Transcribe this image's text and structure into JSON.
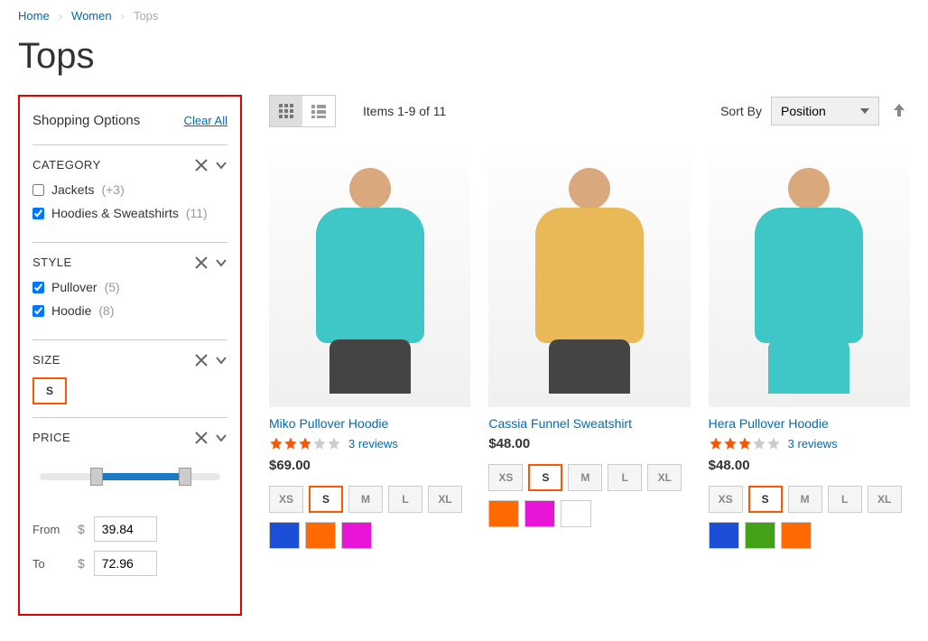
{
  "breadcrumb": {
    "home": "Home",
    "women": "Women",
    "current": "Tops"
  },
  "page_title": "Tops",
  "sidebar": {
    "title": "Shopping Options",
    "clear_all": "Clear All",
    "category": {
      "label": "CATEGORY",
      "items": [
        {
          "label": "Jackets",
          "count": "(+3)",
          "checked": false
        },
        {
          "label": "Hoodies & Sweatshirts",
          "count": "(11)",
          "checked": true
        }
      ]
    },
    "style": {
      "label": "STYLE",
      "items": [
        {
          "label": "Pullover",
          "count": "(5)",
          "checked": true
        },
        {
          "label": "Hoodie",
          "count": "(8)",
          "checked": true
        }
      ]
    },
    "size": {
      "label": "SIZE",
      "selected": "S"
    },
    "price": {
      "label": "PRICE",
      "from_label": "From",
      "to_label": "To",
      "from_value": "39.84",
      "to_value": "72.96",
      "currency": "$"
    }
  },
  "toolbar": {
    "count_text": "Items 1-9 of 11",
    "sortby_label": "Sort By",
    "sortby_value": "Position"
  },
  "sizes": [
    "XS",
    "S",
    "M",
    "L",
    "XL"
  ],
  "products": [
    {
      "name": "Miko Pullover Hoodie",
      "stars": 3,
      "reviews": "3 reviews",
      "price": "$69.00",
      "selected_size": "S",
      "colors": [
        "#1b4fd8",
        "#ff6a00",
        "#e815d6"
      ]
    },
    {
      "name": "Cassia Funnel Sweatshirt",
      "stars": 0,
      "reviews": "",
      "price": "$48.00",
      "selected_size": "S",
      "colors": [
        "#ff6a00",
        "#e815d6",
        "#ffffff"
      ]
    },
    {
      "name": "Hera Pullover Hoodie",
      "stars": 3,
      "reviews": "3 reviews",
      "price": "$48.00",
      "selected_size": "S",
      "colors": [
        "#1b4fd8",
        "#43a215",
        "#ff6a00"
      ]
    }
  ]
}
